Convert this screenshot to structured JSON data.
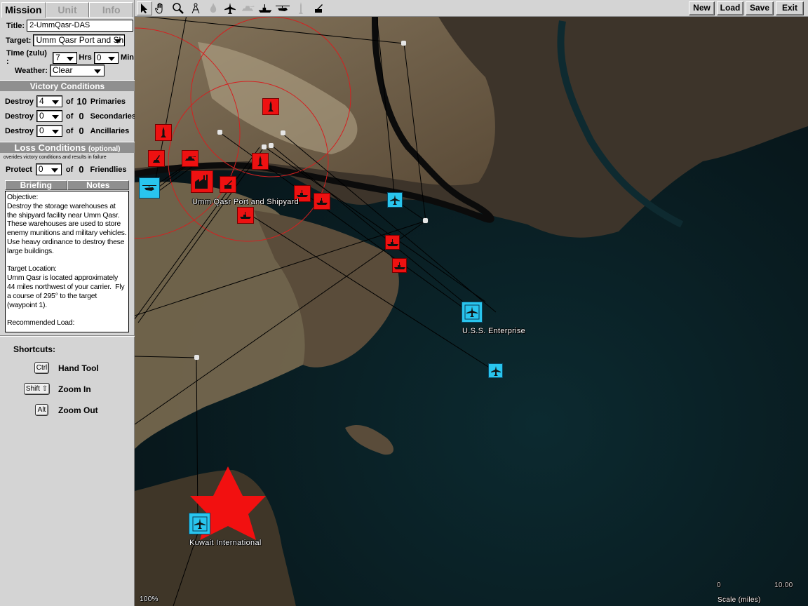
{
  "panel": {
    "tabs": [
      {
        "label": "Mission",
        "active": true
      },
      {
        "label": "Unit",
        "active": false
      },
      {
        "label": "Info",
        "active": false
      }
    ],
    "title_label": "Title:",
    "title_value": "2-UmmQasr-DAS",
    "target_label": "Target:",
    "target_value": "Umm Qasr Port and Shipyard",
    "time_label": "Time (zulu) :",
    "time_hrs_value": "7",
    "hrs_label": "Hrs",
    "time_min_value": "0",
    "min_label": "Min",
    "weather_label": "Weather:",
    "weather_value": "Clear",
    "victory": {
      "header": "Victory Conditions",
      "rows": [
        {
          "verb": "Destroy",
          "value": "4",
          "of": "of",
          "total": "10",
          "kind": "Primaries"
        },
        {
          "verb": "Destroy",
          "value": "0",
          "of": "of",
          "total": "0",
          "kind": "Secondaries"
        },
        {
          "verb": "Destroy",
          "value": "0",
          "of": "of",
          "total": "0",
          "kind": "Ancillaries"
        }
      ]
    },
    "loss": {
      "header": "Loss Conditions",
      "optional": "(optional)",
      "note": "overides victory conditions and results in failure",
      "row": {
        "verb": "Protect",
        "value": "0",
        "of": "of",
        "total": "0",
        "kind": "Friendlies"
      }
    },
    "briefing_tabs": [
      "Briefing",
      "Notes"
    ],
    "briefing_text": "Objective:\nDestroy the storage warehouses at the shipyard facility near Umm Qasr.  These warehouses are used to store enemy munitions and military vehicles.  Use heavy ordinance to destroy these large buildings.\n\nTarget Location:\nUmm Qasr is located approximately 44 miles northwest of your carrier.  Fly a course of 295° to the target (waypoint 1).\n\nRecommended Load:",
    "shortcuts": {
      "title": "Shortcuts:",
      "items": [
        {
          "key": "Ctrl",
          "label": "Hand Tool"
        },
        {
          "key": "Shift ⇧",
          "label": "Zoom In"
        },
        {
          "key": "Alt",
          "label": "Zoom Out"
        }
      ]
    }
  },
  "toolbar": {
    "tools": [
      {
        "name": "select-arrow",
        "active": true,
        "enabled": true
      },
      {
        "name": "hand",
        "active": false,
        "enabled": true
      },
      {
        "name": "zoom-magnifier",
        "active": false,
        "enabled": true
      },
      {
        "name": "compass-divider",
        "active": false,
        "enabled": true
      },
      {
        "name": "fire-target",
        "active": false,
        "enabled": false
      },
      {
        "name": "jet-aircraft",
        "active": false,
        "enabled": true
      },
      {
        "name": "tank",
        "active": false,
        "enabled": false
      },
      {
        "name": "ship",
        "active": false,
        "enabled": true
      },
      {
        "name": "helicopter",
        "active": false,
        "enabled": true
      },
      {
        "name": "missile",
        "active": false,
        "enabled": false
      },
      {
        "name": "sam-launcher",
        "active": false,
        "enabled": true
      }
    ],
    "buttons": [
      "New",
      "Load",
      "Save",
      "Exit"
    ]
  },
  "map": {
    "labels": {
      "target": "Umm Qasr Port and Shipyard",
      "carrier": "U.S.S. Enterprise",
      "airport": "Kuwait International"
    },
    "zoom_level": "100%",
    "scale": {
      "min": "0",
      "max": "10.00",
      "label": "Scale (miles)"
    },
    "colors": {
      "enemy": "#ee1111",
      "friendly": "#29c5ee",
      "threat_ring": "#d42020"
    }
  }
}
